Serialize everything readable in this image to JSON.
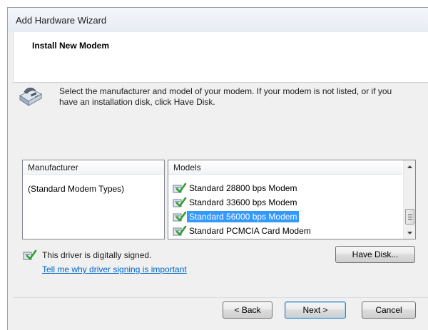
{
  "window": {
    "title": "Add Hardware Wizard"
  },
  "header": {
    "title": "Install New Modem"
  },
  "instructions": "Select the manufacturer and model of your modem. If your modem is not listed, or if you have an installation disk, click Have Disk.",
  "manufacturer_list": {
    "header": "Manufacturer",
    "items": [
      "(Standard Modem Types)"
    ],
    "selected": "(Standard Modem Types)"
  },
  "models_list": {
    "header": "Models",
    "items": [
      {
        "label": "Standard 28800 bps Modem",
        "icon": "signed-driver-icon",
        "selected": false
      },
      {
        "label": "Standard 33600 bps Modem",
        "icon": "signed-driver-icon",
        "selected": false
      },
      {
        "label": "Standard 56000 bps Modem",
        "icon": "signed-driver-icon",
        "selected": true
      },
      {
        "label": "Standard PCMCIA Card Modem",
        "icon": "signed-driver-icon",
        "selected": false
      }
    ]
  },
  "signing": {
    "text": "This driver is digitally signed.",
    "link": "Tell me why driver signing is important"
  },
  "buttons": {
    "have_disk": "Have Disk...",
    "back": "< Back",
    "next": "Next >",
    "cancel": "Cancel"
  },
  "colors": {
    "selection": "#3399ff",
    "link": "#0066cc",
    "check": "#2e9e2e"
  }
}
